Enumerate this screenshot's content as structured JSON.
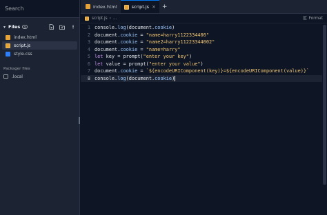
{
  "sidebar": {
    "search_placeholder": "Search",
    "files_label": "Files",
    "files": [
      {
        "name": "index.html",
        "type": "html"
      },
      {
        "name": "script.js",
        "type": "js"
      },
      {
        "name": "style.css",
        "type": "css"
      }
    ],
    "packager_label": "Packager files",
    "packager_item": ".local"
  },
  "tabs": [
    {
      "label": "index.html",
      "type": "html",
      "active": false
    },
    {
      "label": "script.js",
      "type": "js",
      "active": true
    }
  ],
  "breadcrumb": {
    "file": "script.js",
    "sep": "›",
    "more": "..."
  },
  "format_label": "Format",
  "code": {
    "current_line": 8,
    "lines": [
      {
        "n": "1",
        "text": "console.log(document.cookie)"
      },
      {
        "n": "2",
        "text": "document.cookie = \"name=harry1122334400\""
      },
      {
        "n": "3",
        "text": "document.cookie = \"name2=harry11223344002\""
      },
      {
        "n": "4",
        "text": "document.cookie = \"name=harry\""
      },
      {
        "n": "5",
        "text": "let key = prompt(\"enter your key\")"
      },
      {
        "n": "6",
        "text": "let value = prompt(\"enter your value\")"
      },
      {
        "n": "7",
        "text": "document.cookie = `${encodeURIComponent(key)}=${encodeURIComponent(value)}`"
      },
      {
        "n": "8",
        "text": "console.log(document.cookie)"
      }
    ]
  }
}
